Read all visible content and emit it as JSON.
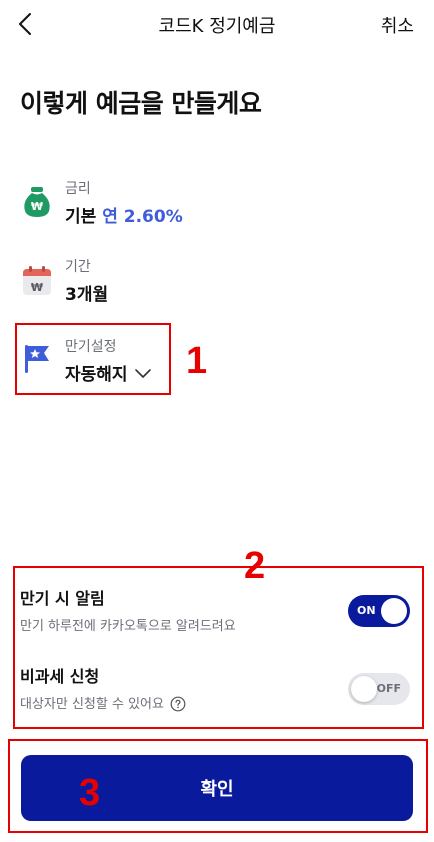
{
  "header": {
    "title": "코드K 정기예금",
    "cancel_label": "취소"
  },
  "headline": "이렇게 예금을 만들게요",
  "info": {
    "rate": {
      "label": "금리",
      "prefix": "기본",
      "value": "연 2.60%",
      "icon": "money-bag-icon"
    },
    "period": {
      "label": "기간",
      "value": "3개월",
      "icon": "calendar-icon"
    },
    "maturity": {
      "label": "만기설정",
      "value": "자동해지",
      "icon": "flag-icon"
    }
  },
  "settings": {
    "maturity_alert": {
      "title": "만기 시 알림",
      "description": "만기 하루전에 카카오톡으로 알려드려요",
      "toggle_label": "ON",
      "enabled": true
    },
    "tax_free": {
      "title": "비과세 신청",
      "description": "대상자만 신청할 수 있어요",
      "toggle_label": "OFF",
      "enabled": false
    }
  },
  "confirm_label": "확인",
  "annotations": {
    "mark1": "1",
    "mark2": "2",
    "mark3": "3"
  },
  "colors": {
    "primary": "#0a1a9c",
    "accent": "#3f5ddb",
    "money_bag": "#1f9a63",
    "flag": "#3f5ddb",
    "calendar": "#e5645a",
    "annotation": "#e60000"
  }
}
